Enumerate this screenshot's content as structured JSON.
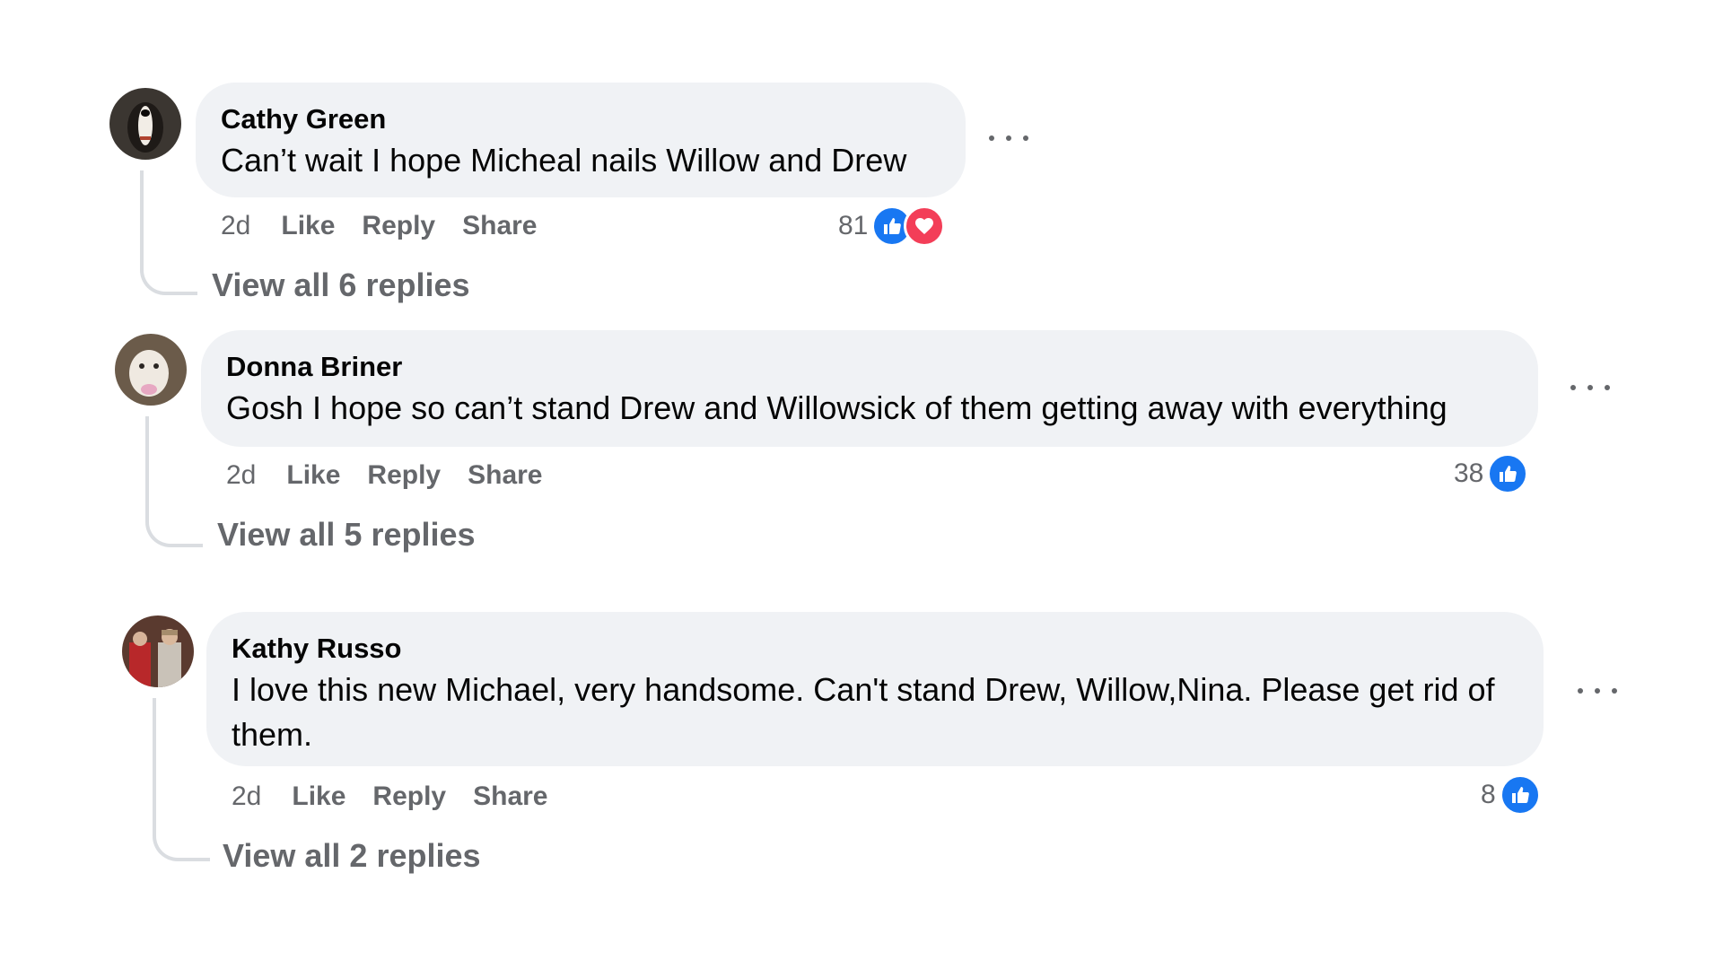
{
  "comments": [
    {
      "author": "Cathy Green",
      "text": "Can’t wait I hope Micheal nails Willow and Drew",
      "time": "2d",
      "like_label": "Like",
      "reply_label": "Reply",
      "share_label": "Share",
      "reaction_count": "81",
      "reactions": [
        "like-icon",
        "love-icon"
      ],
      "view_replies": "View all 6 replies"
    },
    {
      "author": "Donna Briner",
      "text": "Gosh I hope so can’t stand Drew and Willowsick of them getting away with everything",
      "time": "2d",
      "like_label": "Like",
      "reply_label": "Reply",
      "share_label": "Share",
      "reaction_count": "38",
      "reactions": [
        "like-icon"
      ],
      "view_replies": "View all 5 replies"
    },
    {
      "author": "Kathy Russo",
      "text": "I love this new Michael, very handsome. Can't stand Drew, Willow,Nina. Please get rid of them.",
      "time": "2d",
      "like_label": "Like",
      "reply_label": "Reply",
      "share_label": "Share",
      "reaction_count": "8",
      "reactions": [
        "like-icon"
      ],
      "view_replies": "View all 2 replies"
    }
  ],
  "colors": {
    "bubble": "#f0f2f5",
    "secondary_text": "#65676b",
    "like_blue": "#1877f2",
    "love_red": "#f33e58"
  }
}
